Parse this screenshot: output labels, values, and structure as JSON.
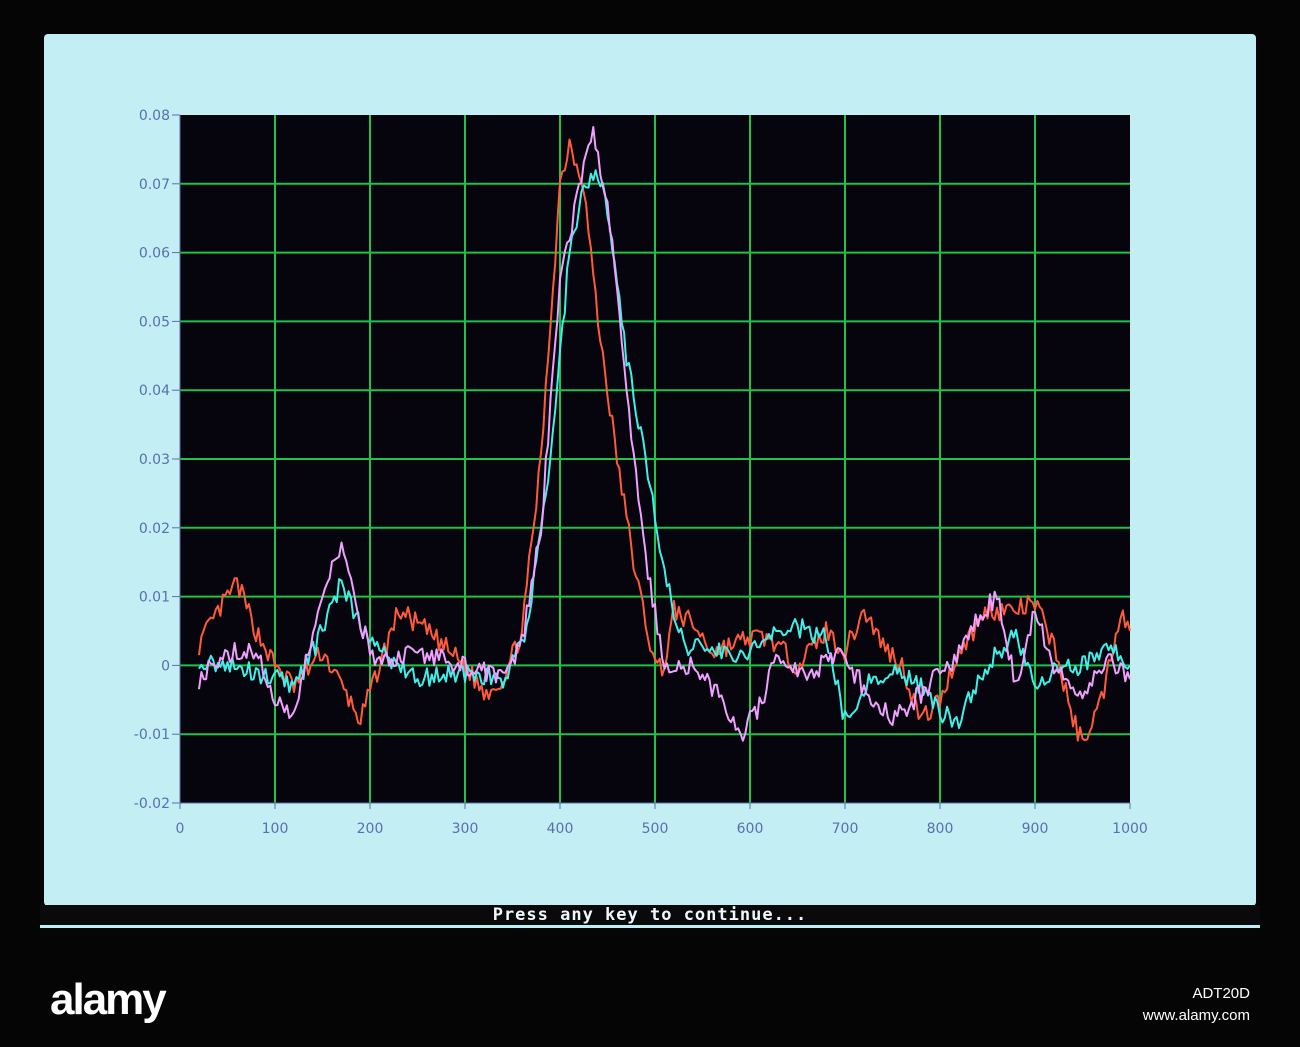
{
  "status_text": "Press any key to continue...",
  "footer": {
    "logo": "alamy",
    "image_id": "ADT20D",
    "site": "www.alamy.com"
  },
  "colors": {
    "plot_bg": "#06040c",
    "grid": "#1fc24a",
    "red": "#ff5a3c",
    "cyan": "#40f0e8",
    "magenta": "#f0a0ff"
  },
  "chart_data": {
    "type": "line",
    "title": "",
    "xlabel": "",
    "ylabel": "",
    "xlim": [
      0,
      1000
    ],
    "ylim": [
      -0.02,
      0.08
    ],
    "grid": true,
    "xticks": [
      "0",
      "100",
      "200",
      "300",
      "400",
      "500",
      "600",
      "700",
      "800",
      "900",
      "1000"
    ],
    "yticks": [
      "-0.02",
      "-0.01",
      "0",
      "0.01",
      "0.02",
      "0.03",
      "0.04",
      "0.05",
      "0.06",
      "0.07",
      "0.08"
    ],
    "series": [
      {
        "name": "red",
        "color": "#ff5a3c",
        "x": [
          20,
          50,
          60,
          80,
          100,
          120,
          150,
          170,
          190,
          210,
          230,
          260,
          300,
          320,
          340,
          360,
          380,
          400,
          410,
          425,
          440,
          460,
          480,
          500,
          510,
          520,
          540,
          560,
          600,
          620,
          650,
          680,
          700,
          720,
          740,
          760,
          780,
          800,
          820,
          850,
          880,
          900,
          920,
          940,
          950,
          970,
          990,
          1000
        ],
        "y": [
          0.003,
          0.01,
          0.012,
          0.005,
          0.0,
          -0.003,
          0.002,
          -0.003,
          -0.008,
          0.0,
          0.008,
          0.005,
          0.0,
          -0.004,
          -0.002,
          0.005,
          0.03,
          0.07,
          0.076,
          0.07,
          0.05,
          0.03,
          0.013,
          0.0,
          0.0,
          0.008,
          0.006,
          0.002,
          0.004,
          0.004,
          0.0,
          0.005,
          0.002,
          0.008,
          0.003,
          0.0,
          -0.008,
          -0.005,
          0.002,
          0.008,
          0.008,
          0.009,
          0.003,
          -0.008,
          -0.011,
          -0.005,
          0.008,
          0.005
        ]
      },
      {
        "name": "cyan",
        "color": "#40f0e8",
        "x": [
          20,
          50,
          80,
          100,
          120,
          140,
          170,
          190,
          210,
          250,
          300,
          340,
          360,
          370,
          390,
          410,
          425,
          440,
          450,
          470,
          490,
          510,
          530,
          560,
          600,
          640,
          680,
          700,
          720,
          750,
          780,
          800,
          820,
          850,
          880,
          900,
          920,
          950,
          980,
          1000
        ],
        "y": [
          0.001,
          0.0,
          -0.001,
          -0.002,
          -0.003,
          0.002,
          0.012,
          0.006,
          0.002,
          -0.002,
          -0.001,
          -0.002,
          0.003,
          0.01,
          0.03,
          0.06,
          0.07,
          0.072,
          0.066,
          0.045,
          0.03,
          0.013,
          0.003,
          0.002,
          0.002,
          0.006,
          0.004,
          -0.008,
          -0.003,
          0.0,
          -0.003,
          -0.007,
          -0.008,
          0.0,
          0.005,
          -0.004,
          -0.001,
          0.0,
          0.003,
          0.0
        ]
      },
      {
        "name": "magenta",
        "color": "#f0a0ff",
        "x": [
          20,
          50,
          80,
          100,
          120,
          140,
          170,
          190,
          210,
          250,
          300,
          340,
          360,
          380,
          400,
          420,
          435,
          450,
          470,
          490,
          510,
          540,
          560,
          590,
          610,
          630,
          660,
          690,
          720,
          750,
          780,
          810,
          840,
          860,
          880,
          900,
          920,
          950,
          980,
          1000
        ],
        "y": [
          -0.002,
          0.002,
          0.002,
          -0.005,
          -0.008,
          0.005,
          0.018,
          0.006,
          0.0,
          0.002,
          0.0,
          -0.002,
          0.003,
          0.02,
          0.055,
          0.07,
          0.077,
          0.068,
          0.04,
          0.015,
          0.0,
          0.0,
          -0.003,
          -0.01,
          -0.006,
          0.002,
          -0.002,
          0.002,
          -0.003,
          -0.008,
          -0.004,
          0.0,
          0.007,
          0.01,
          -0.003,
          0.008,
          0.0,
          -0.004,
          0.001,
          -0.002
        ]
      }
    ]
  }
}
